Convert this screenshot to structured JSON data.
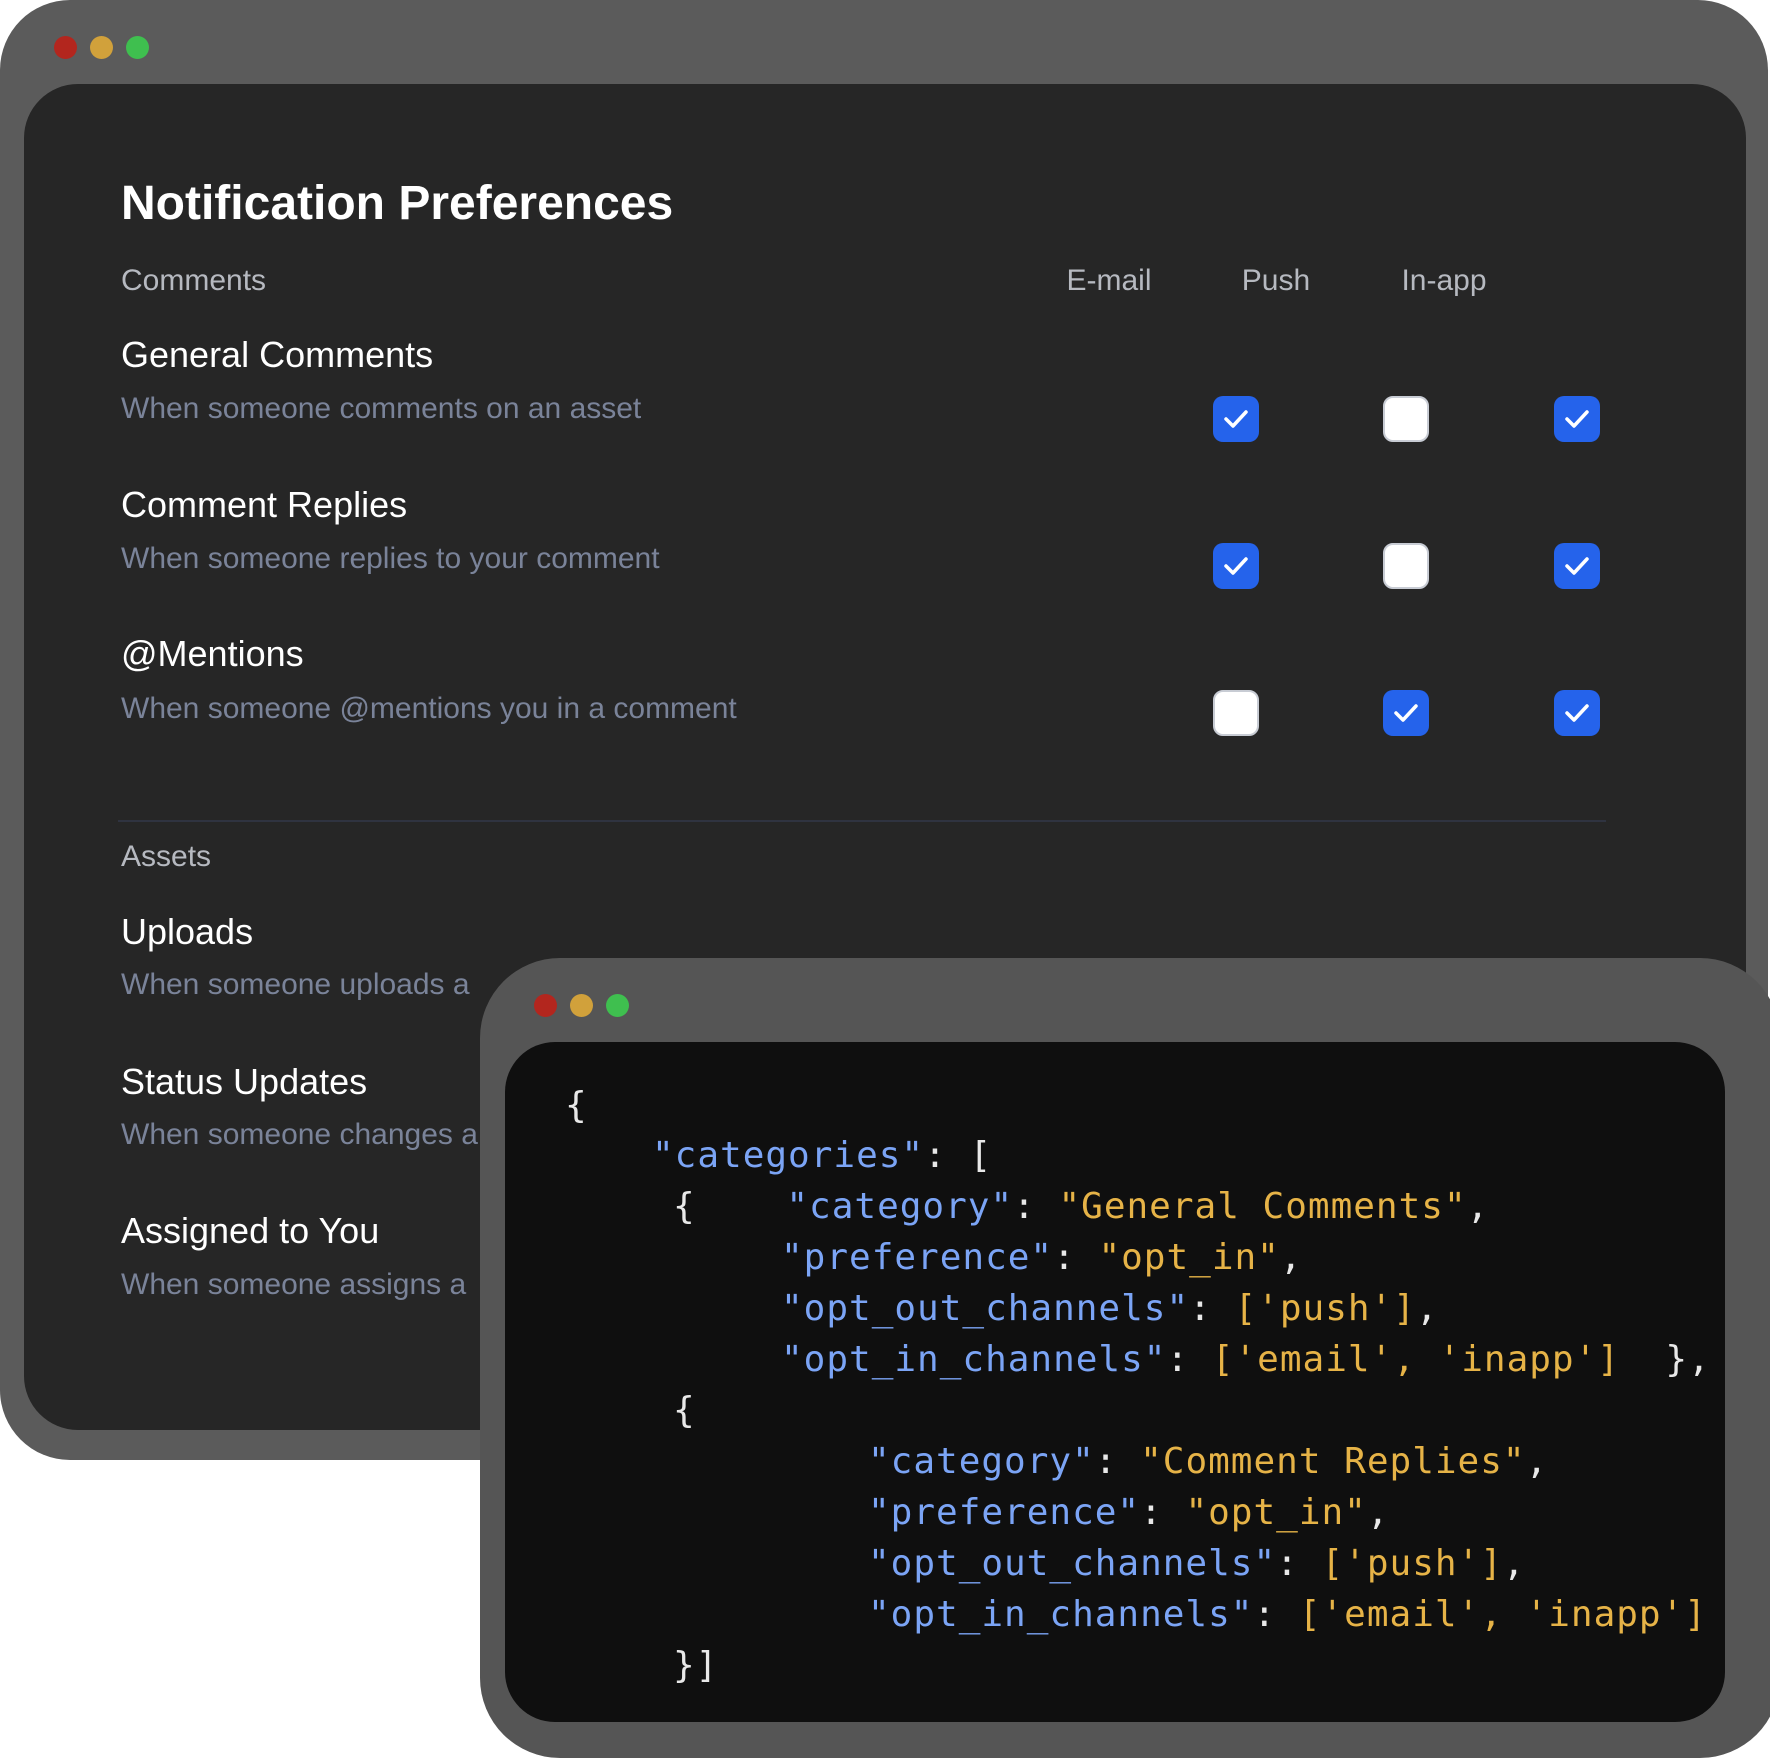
{
  "window_dots": {
    "red": "#b3261e",
    "yellow": "#d1a13b",
    "green": "#3fbf4f"
  },
  "settings": {
    "title": "Notification Preferences",
    "columns": [
      "E-mail",
      "Push",
      "In-app"
    ],
    "sections": [
      {
        "name": "Comments",
        "rows": [
          {
            "title": "General Comments",
            "desc": "When someone comments on an asset",
            "email": true,
            "push": false,
            "inapp": true
          },
          {
            "title": "Comment Replies",
            "desc": "When someone replies to your comment",
            "email": true,
            "push": false,
            "inapp": true
          },
          {
            "title": "@Mentions",
            "desc": "When someone @mentions you in a comment",
            "email": false,
            "push": true,
            "inapp": true
          }
        ]
      },
      {
        "name": "Assets",
        "rows": [
          {
            "title": "Uploads",
            "desc": "When someone uploads a"
          },
          {
            "title": "Status Updates",
            "desc": "When someone changes a"
          },
          {
            "title": "Assigned to You",
            "desc": "When someone assigns a"
          }
        ]
      }
    ]
  },
  "code_lines": [
    [
      [
        "p",
        "{"
      ]
    ],
    [
      [
        "k",
        "\"categories\""
      ],
      [
        "p",
        ": ["
      ]
    ],
    [
      [
        "p",
        "{    "
      ],
      [
        "k",
        "\"category\""
      ],
      [
        "p",
        ": "
      ],
      [
        "s",
        "\"General Comments\""
      ],
      [
        "p",
        ","
      ]
    ],
    [
      [
        "k",
        "\"preference\""
      ],
      [
        "p",
        ": "
      ],
      [
        "s",
        "\"opt_in\""
      ],
      [
        "p",
        ","
      ]
    ],
    [
      [
        "k",
        "\"opt_out_channels\""
      ],
      [
        "p",
        ": "
      ],
      [
        "s",
        "['push']"
      ],
      [
        "p",
        ","
      ]
    ],
    [
      [
        "k",
        "\"opt_in_channels\""
      ],
      [
        "p",
        ": "
      ],
      [
        "s",
        "['email', 'inapp']"
      ],
      [
        "p",
        "  },"
      ]
    ],
    [
      [
        "p",
        "{"
      ]
    ],
    [
      [
        "k",
        "\"category\""
      ],
      [
        "p",
        ": "
      ],
      [
        "s",
        "\"Comment Replies\""
      ],
      [
        "p",
        ","
      ]
    ],
    [
      [
        "k",
        "\"preference\""
      ],
      [
        "p",
        ": "
      ],
      [
        "s",
        "\"opt_in\""
      ],
      [
        "p",
        ","
      ]
    ],
    [
      [
        "k",
        "\"opt_out_channels\""
      ],
      [
        "p",
        ": "
      ],
      [
        "s",
        "['push']"
      ],
      [
        "p",
        ","
      ]
    ],
    [
      [
        "k",
        "\"opt_in_channels\""
      ],
      [
        "p",
        ": "
      ],
      [
        "s",
        "['email', 'inapp']"
      ]
    ],
    [
      [
        "p",
        "}]"
      ]
    ]
  ]
}
